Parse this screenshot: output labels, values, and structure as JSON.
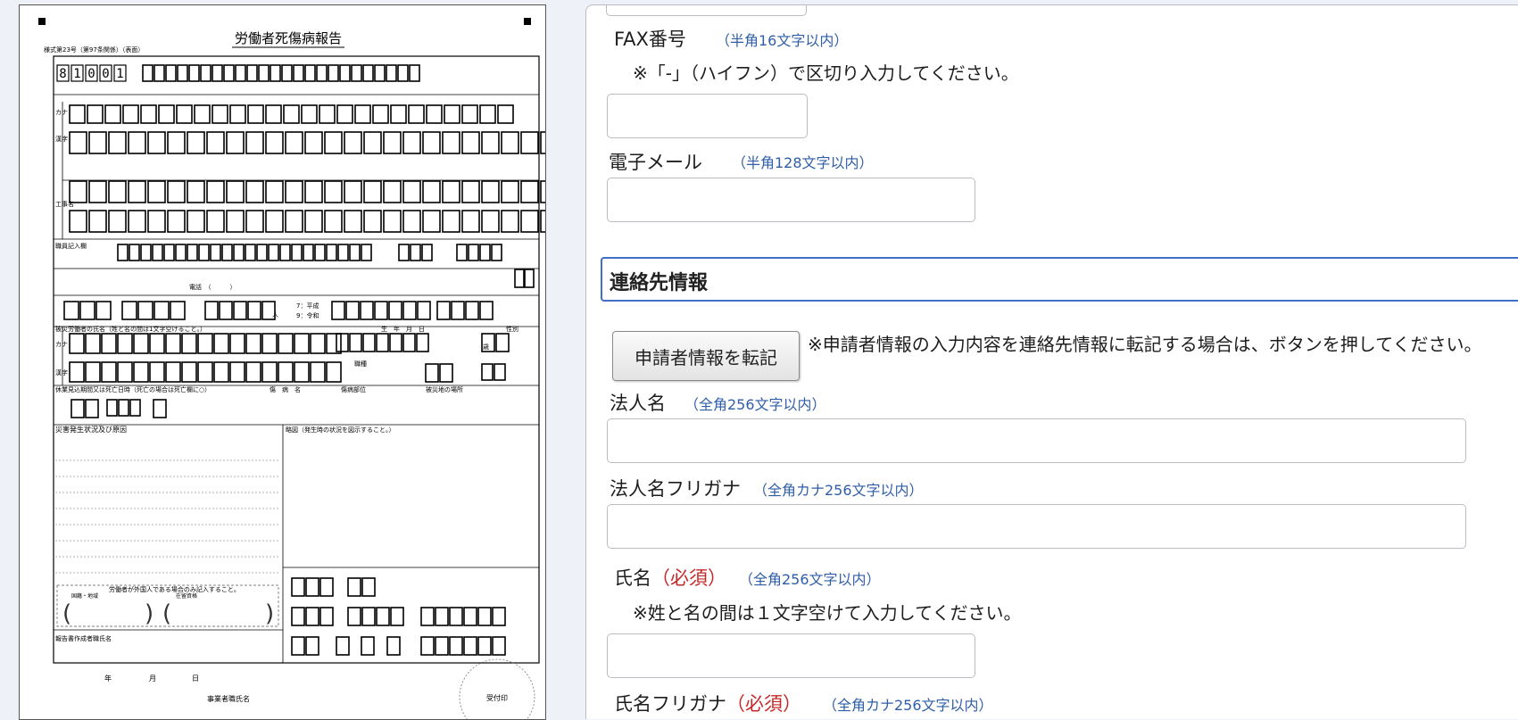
{
  "form_preview": {
    "title": "労働者死傷病報告",
    "form_number": "様式第23号（第97条関係）（表面）",
    "code_digits": [
      "8",
      "1",
      "0",
      "0",
      "1"
    ],
    "labels": {
      "kana": "カナ",
      "kanji": "漢字",
      "koji_mei": "工事名",
      "shokuin": "職員記入欄",
      "telephone": "電話　（　　　）",
      "victim_name": "被災労働者の氏名（姓と名の間は1文字空けること。）",
      "birth": "生　年　月　日",
      "sex": "性別",
      "job": "職種",
      "era_heisei": "7：平成",
      "era_reiwa": "9：令和",
      "leave": "休業見込期間又は死亡日時（死亡の場合は死亡欄に○）",
      "injury": "傷　病　名",
      "injury_part": "傷病部位",
      "place": "被災地の場所",
      "cause": "災害発生状況及び原因",
      "sketch": "略図（発生時の状況を図示すること。）",
      "foreign": "労働者が外国人である場合のみ記入すること。",
      "country": "国籍・地域",
      "residence": "在留資格",
      "reporter": "報告書作成者職氏名",
      "year": "年",
      "month": "月",
      "day": "日",
      "employer": "事業者職氏名",
      "stamp": "受付印",
      "age_unit": "歳",
      "person_unit": "人"
    }
  },
  "panel": {
    "fax": {
      "label": "FAX番号",
      "hint": "（半角16文字以内）",
      "note": "※「-」（ハイフン）で区切り入力してください。",
      "value": ""
    },
    "email": {
      "label": "電子メール",
      "hint": "（半角128文字以内）",
      "value": ""
    },
    "section_title": "連絡先情報",
    "transfer_button": "申請者情報を転記",
    "transfer_note": "※申請者情報の入力内容を連絡先情報に転記する場合は、ボタンを押してください。",
    "corp_name": {
      "label": "法人名",
      "hint": "（全角256文字以内）",
      "value": ""
    },
    "corp_kana": {
      "label": "法人名フリガナ",
      "hint": "（全角カナ256文字以内）",
      "value": ""
    },
    "name": {
      "label": "氏名",
      "required": "（必須）",
      "hint": "（全角256文字以内）",
      "note": "※姓と名の間は１文字空けて入力してください。",
      "value": ""
    },
    "name_kana": {
      "label": "氏名フリガナ",
      "required": "（必須）",
      "hint": "（全角カナ256文字以内）"
    }
  },
  "colors": {
    "hint": "#2f5ea8",
    "required": "#c62828",
    "section_border": "#3f6fc4",
    "page_background": "#eef1f8"
  }
}
